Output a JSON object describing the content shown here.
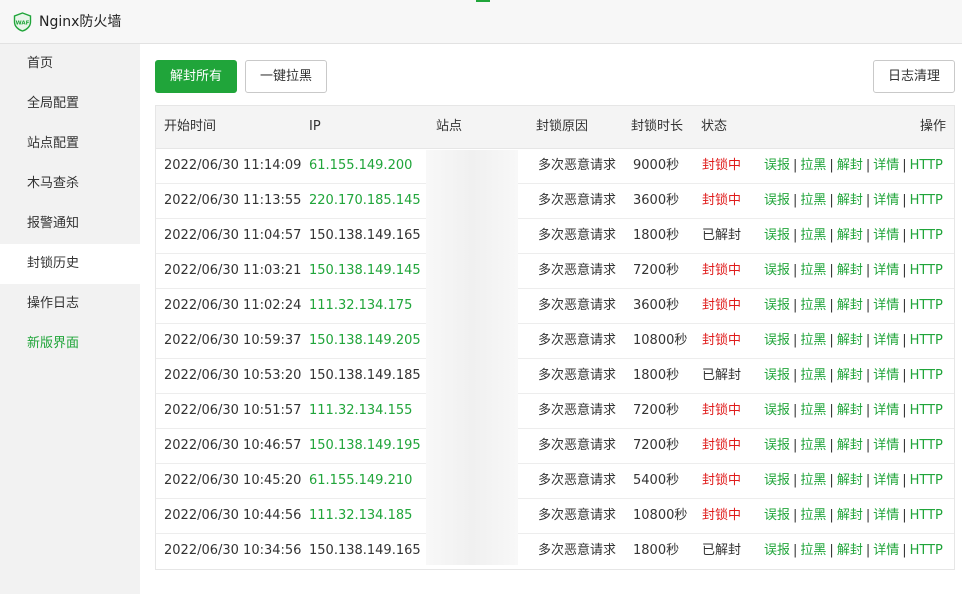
{
  "app": {
    "title": "Nginx防火墙",
    "logo_text": "WAF"
  },
  "colors": {
    "accent": "#20a53a",
    "blocked": "#e01c1c"
  },
  "sidebar": {
    "items": [
      {
        "label": "首页"
      },
      {
        "label": "全局配置"
      },
      {
        "label": "站点配置"
      },
      {
        "label": "木马查杀"
      },
      {
        "label": "报警通知"
      },
      {
        "label": "封锁历史",
        "active": true
      },
      {
        "label": "操作日志"
      },
      {
        "label": "新版界面",
        "highlight": true
      }
    ]
  },
  "toolbar": {
    "unblock_all_label": "解封所有",
    "blacklist_label": "一键拉黑",
    "clear_logs_label": "日志清理"
  },
  "table": {
    "headers": {
      "start_time": "开始时间",
      "ip": "IP",
      "site": "站点",
      "reason": "封锁原因",
      "duration": "封锁时长",
      "status": "状态",
      "actions": "操作"
    },
    "action_labels": [
      "误报",
      "拉黑",
      "解封",
      "详情",
      "HTTP"
    ],
    "rows": [
      {
        "time": "2022/06/30 11:14:09",
        "ip": "61.155.149.200",
        "reason": "多次恶意请求",
        "duration": "9000秒",
        "status": "封锁中"
      },
      {
        "time": "2022/06/30 11:13:55",
        "ip": "220.170.185.145",
        "reason": "多次恶意请求",
        "duration": "3600秒",
        "status": "封锁中"
      },
      {
        "time": "2022/06/30 11:04:57",
        "ip": "150.138.149.165",
        "reason": "多次恶意请求",
        "duration": "1800秒",
        "status": "已解封"
      },
      {
        "time": "2022/06/30 11:03:21",
        "ip": "150.138.149.145",
        "reason": "多次恶意请求",
        "duration": "7200秒",
        "status": "封锁中"
      },
      {
        "time": "2022/06/30 11:02:24",
        "ip": "111.32.134.175",
        "reason": "多次恶意请求",
        "duration": "3600秒",
        "status": "封锁中"
      },
      {
        "time": "2022/06/30 10:59:37",
        "ip": "150.138.149.205",
        "reason": "多次恶意请求",
        "duration": "10800秒",
        "status": "封锁中"
      },
      {
        "time": "2022/06/30 10:53:20",
        "ip": "150.138.149.185",
        "reason": "多次恶意请求",
        "duration": "1800秒",
        "status": "已解封"
      },
      {
        "time": "2022/06/30 10:51:57",
        "ip": "111.32.134.155",
        "reason": "多次恶意请求",
        "duration": "7200秒",
        "status": "封锁中"
      },
      {
        "time": "2022/06/30 10:46:57",
        "ip": "150.138.149.195",
        "reason": "多次恶意请求",
        "duration": "7200秒",
        "status": "封锁中"
      },
      {
        "time": "2022/06/30 10:45:20",
        "ip": "61.155.149.210",
        "reason": "多次恶意请求",
        "duration": "5400秒",
        "status": "封锁中"
      },
      {
        "time": "2022/06/30 10:44:56",
        "ip": "111.32.134.185",
        "reason": "多次恶意请求",
        "duration": "10800秒",
        "status": "封锁中"
      },
      {
        "time": "2022/06/30 10:34:56",
        "ip": "150.138.149.165",
        "reason": "多次恶意请求",
        "duration": "1800秒",
        "status": "已解封"
      }
    ]
  }
}
